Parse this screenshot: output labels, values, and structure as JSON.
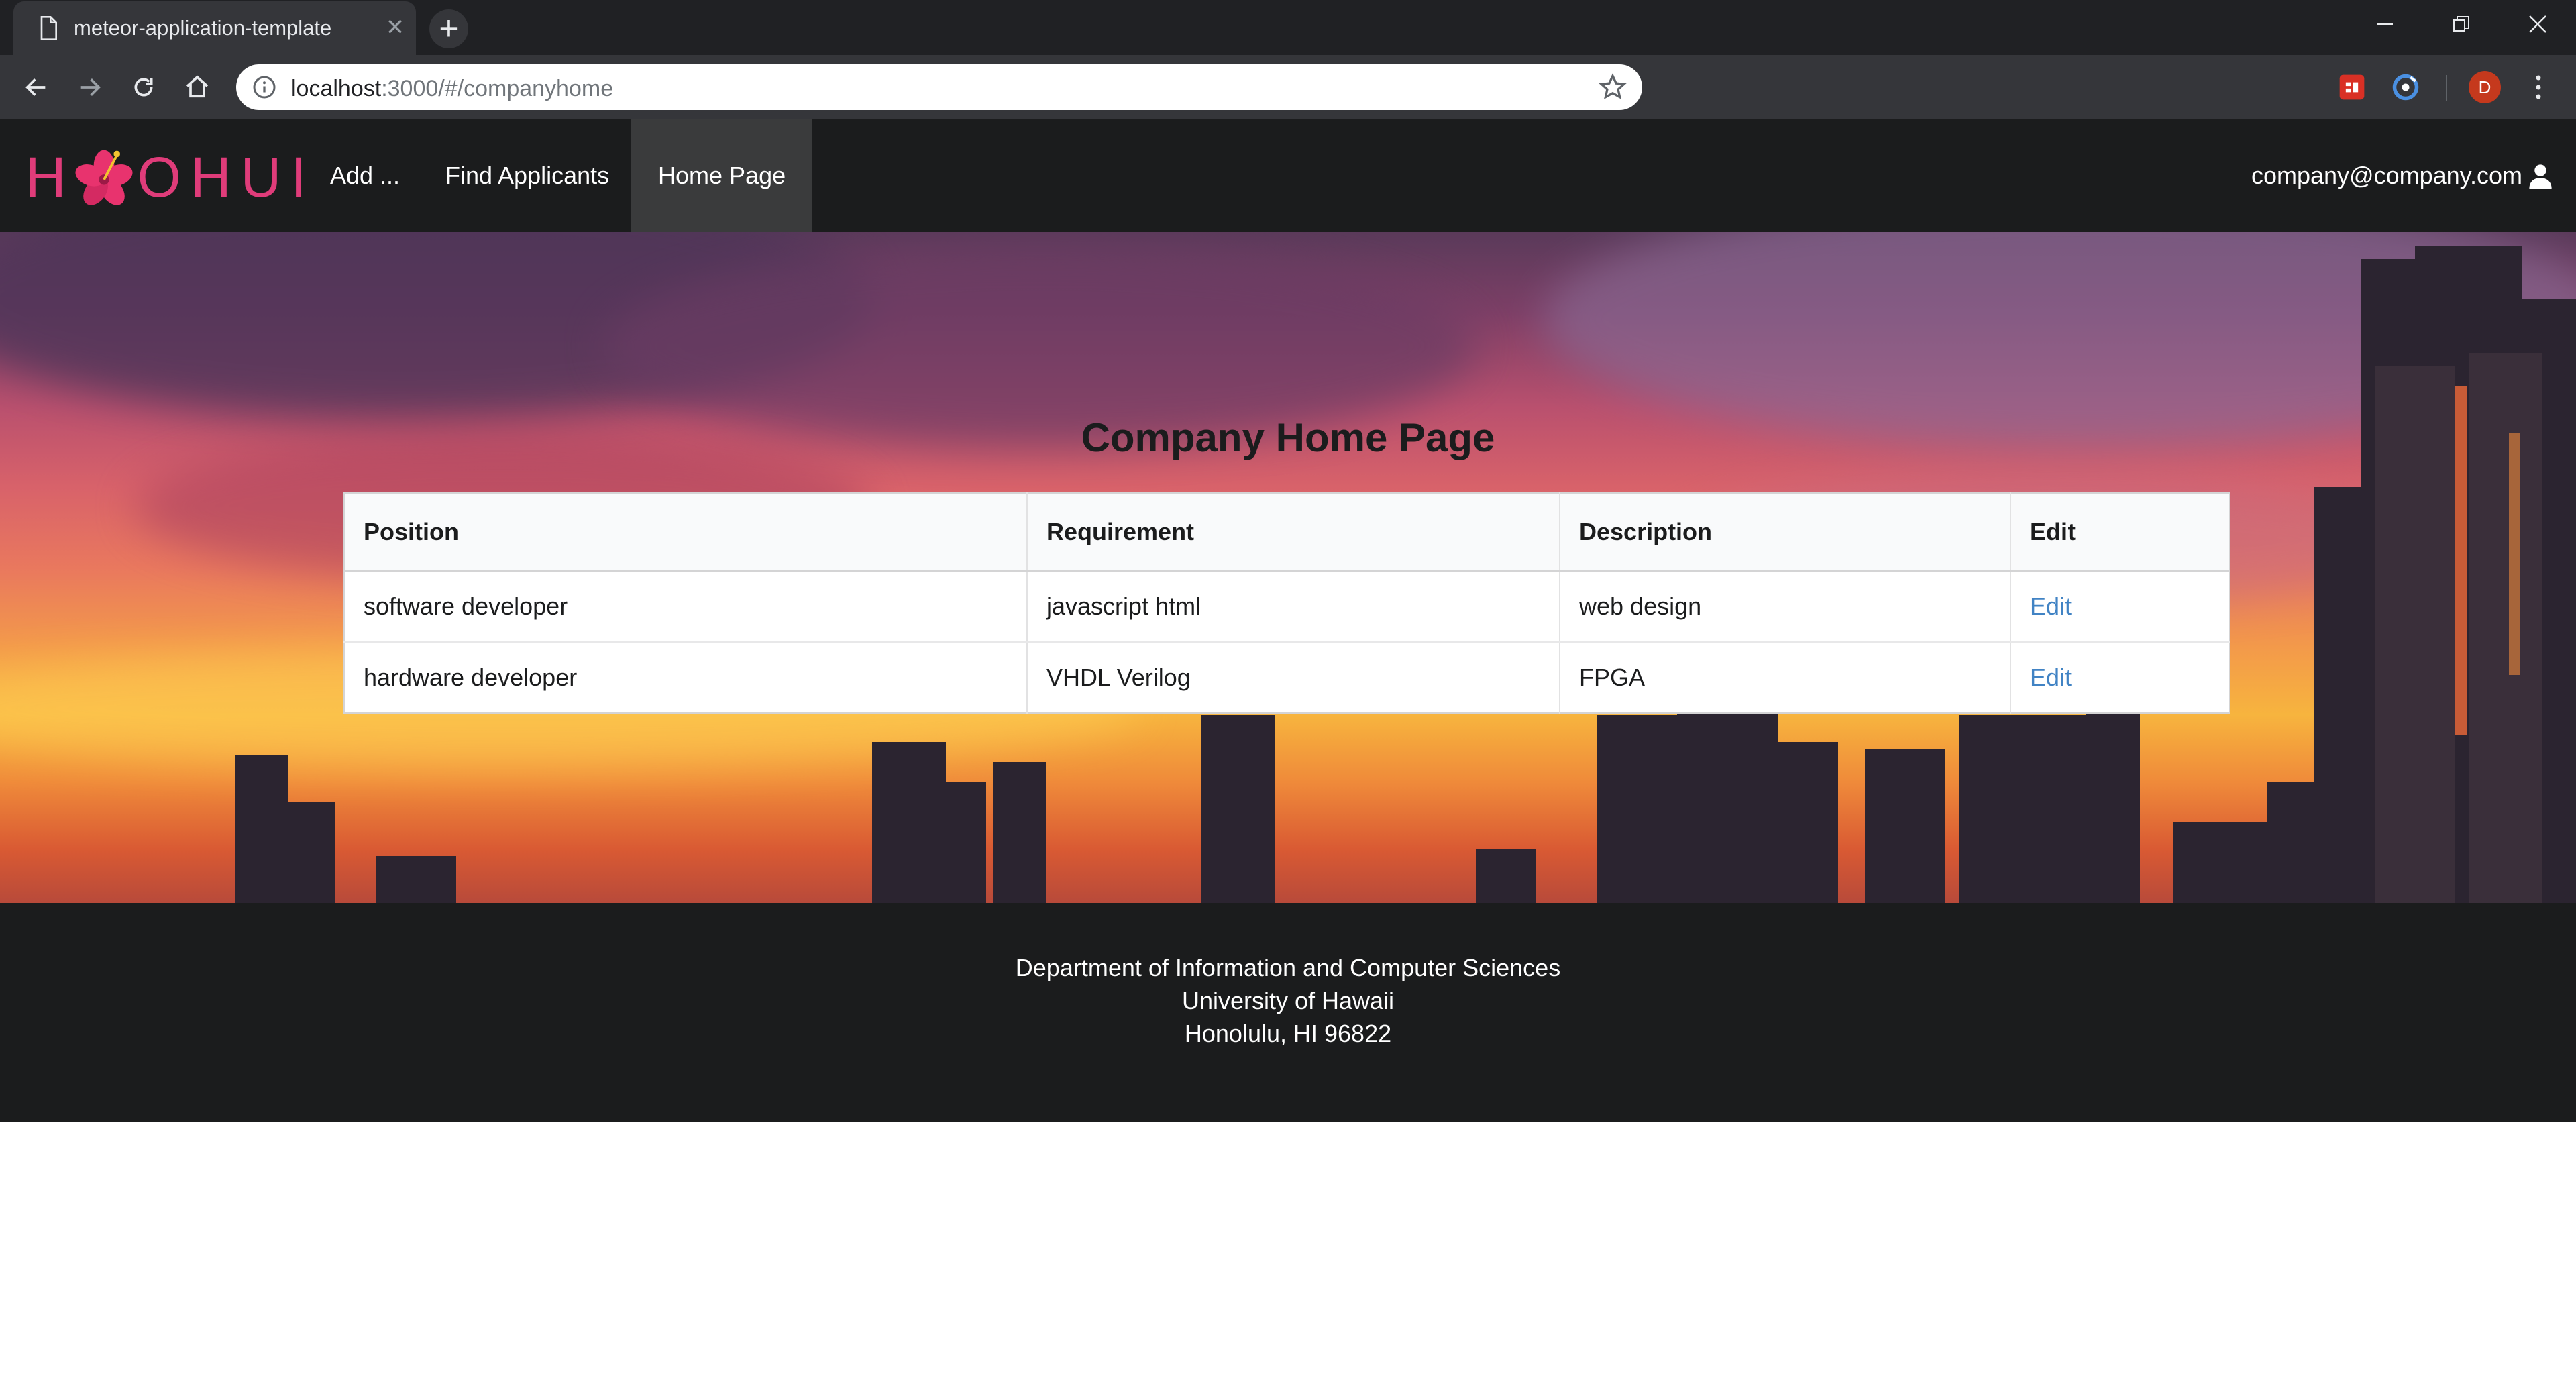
{
  "browser": {
    "tab_title": "meteor-application-template",
    "url_host": "localhost",
    "url_rest": ":3000/#/companyhome",
    "profile_initial": "D"
  },
  "navbar": {
    "logo_before": "H",
    "logo_after": "OHUI",
    "items": [
      {
        "label": "Add ..."
      },
      {
        "label": "Find Applicants"
      },
      {
        "label": "Home Page",
        "active": true
      }
    ],
    "user_email": "company@company.com"
  },
  "main": {
    "title": "Company Home Page",
    "table": {
      "headers": [
        "Position",
        "Requirement",
        "Description",
        "Edit"
      ],
      "rows": [
        {
          "position": "software developer",
          "requirement": "javascript html",
          "description": "web design",
          "edit": "Edit"
        },
        {
          "position": "hardware developer",
          "requirement": "VHDL Verilog",
          "description": "FPGA",
          "edit": "Edit"
        }
      ]
    }
  },
  "footer": {
    "line1": "Department of Information and Computer Sciences",
    "line2": "University of Hawaii",
    "line3": "Honolulu, HI 96822"
  },
  "colors": {
    "navbar_bg": "#1b1c1d",
    "logo_pink": "#e03c7a",
    "link_blue": "#4183c4",
    "chrome_dark": "#202124"
  }
}
